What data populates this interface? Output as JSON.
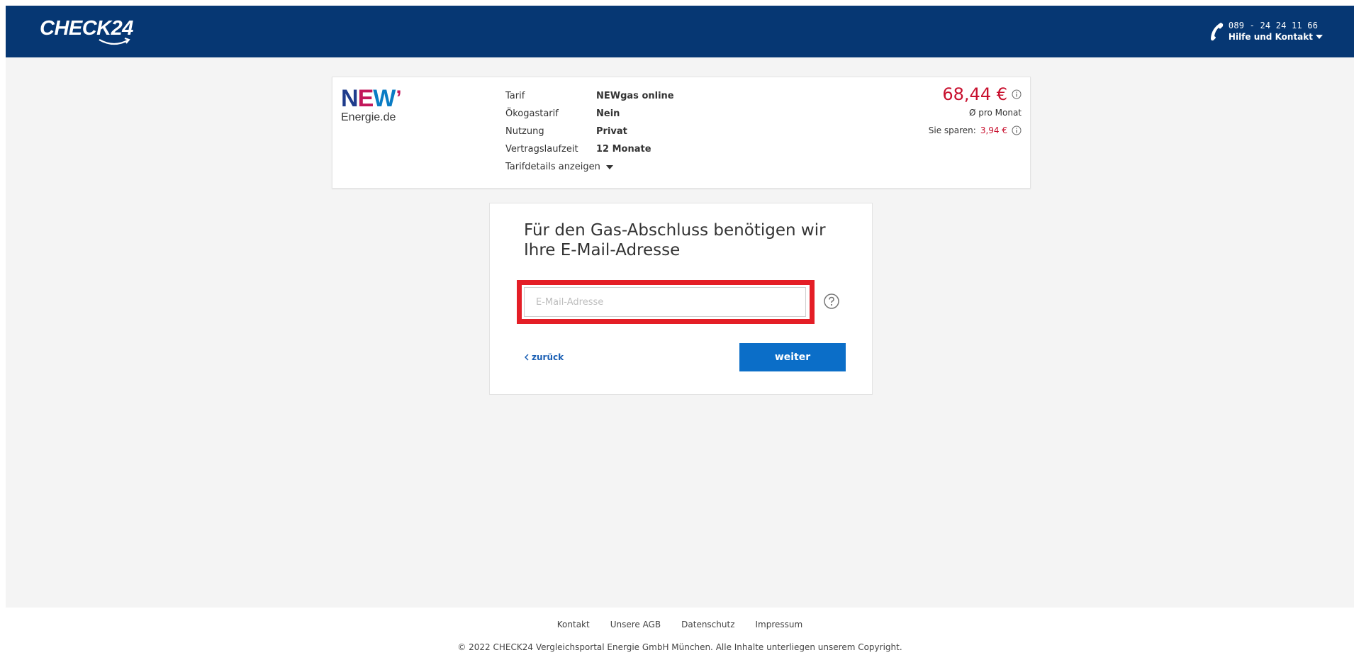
{
  "header": {
    "logo_text": "CHECK24",
    "phone": "089 - 24 24 11 66",
    "help_label": "Hilfe und Kontakt"
  },
  "tariff": {
    "provider_logo_main": "NEW’",
    "provider_logo_sub": "Energie.de",
    "rows": [
      {
        "label": "Tarif",
        "value": "NEWgas online"
      },
      {
        "label": "Ökogastarif",
        "value": "Nein"
      },
      {
        "label": "Nutzung",
        "value": "Privat"
      },
      {
        "label": "Vertragslaufzeit",
        "value": "12 Monate"
      }
    ],
    "details_link": "Tarifdetails anzeigen",
    "price": "68,44 €",
    "per_month": "Ø pro Monat",
    "savings_label": "Sie sparen:",
    "savings_amount": "3,94 €"
  },
  "email_form": {
    "title": "Für den Gas-Abschluss benötigen wir Ihre E-Mail-Adresse",
    "input_value": "",
    "input_placeholder": "E-Mail-Adresse",
    "back_label": "zurück",
    "next_label": "weiter"
  },
  "footer": {
    "links": [
      "Kontakt",
      "Unsere AGB",
      "Datenschutz",
      "Impressum"
    ],
    "copyright": "© 2022 CHECK24 Vergleichsportal Energie GmbH München. Alle Inhalte unterliegen unserem Copyright."
  },
  "colors": {
    "header_bg": "#063773",
    "accent_red": "#c8102e",
    "highlight_red": "#e41e26",
    "button_blue": "#0b6ec8"
  }
}
